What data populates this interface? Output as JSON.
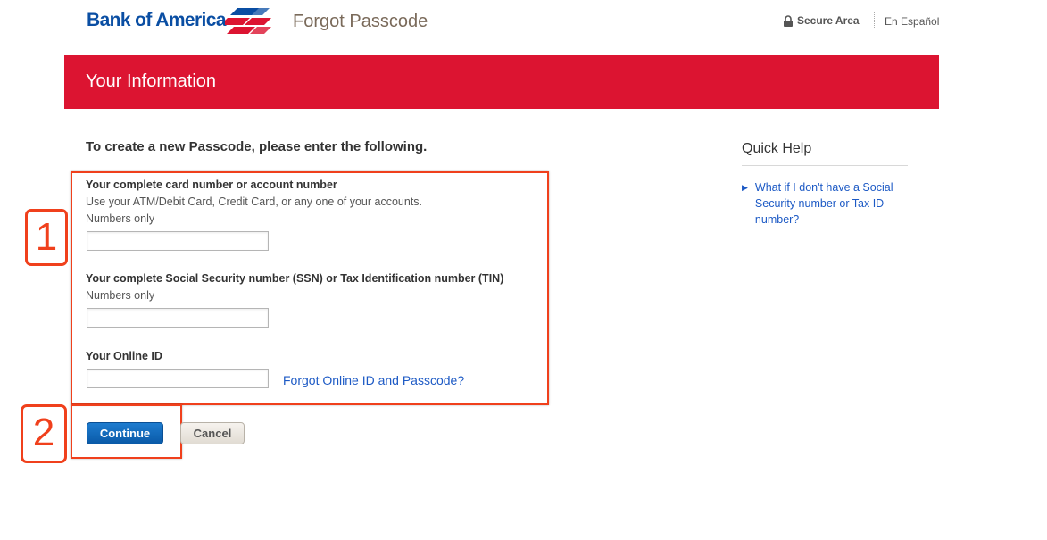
{
  "header": {
    "logo_text": "Bank of America",
    "page_title": "Forgot Passcode",
    "secure_label": "Secure Area",
    "lang_link": "En Español"
  },
  "banner": {
    "title": "Your Information"
  },
  "form": {
    "instruction": "To create a new Passcode, please enter the following.",
    "card_label": "Your complete card number or account number",
    "card_help": "Use your ATM/Debit Card, Credit Card, or any one of your accounts.",
    "card_hint": "Numbers only",
    "card_value": "",
    "ssn_label": "Your complete Social Security number (SSN) or Tax Identification number (TIN)",
    "ssn_hint": "Numbers only",
    "ssn_value": "",
    "online_id_label": "Your Online ID",
    "online_id_value": "",
    "forgot_link": "Forgot Online ID and Passcode?",
    "continue_label": "Continue",
    "cancel_label": "Cancel"
  },
  "annotations": {
    "step1": "1",
    "step2": "2"
  },
  "quick_help": {
    "title": "Quick Help",
    "items": [
      {
        "label": "What if I don't have a Social Security number or Tax ID number?"
      }
    ]
  },
  "colors": {
    "brand_blue": "#0a4ea3",
    "banner_red": "#dc1431",
    "annotation_red": "#f0401c",
    "link_blue": "#1d5ac5"
  }
}
